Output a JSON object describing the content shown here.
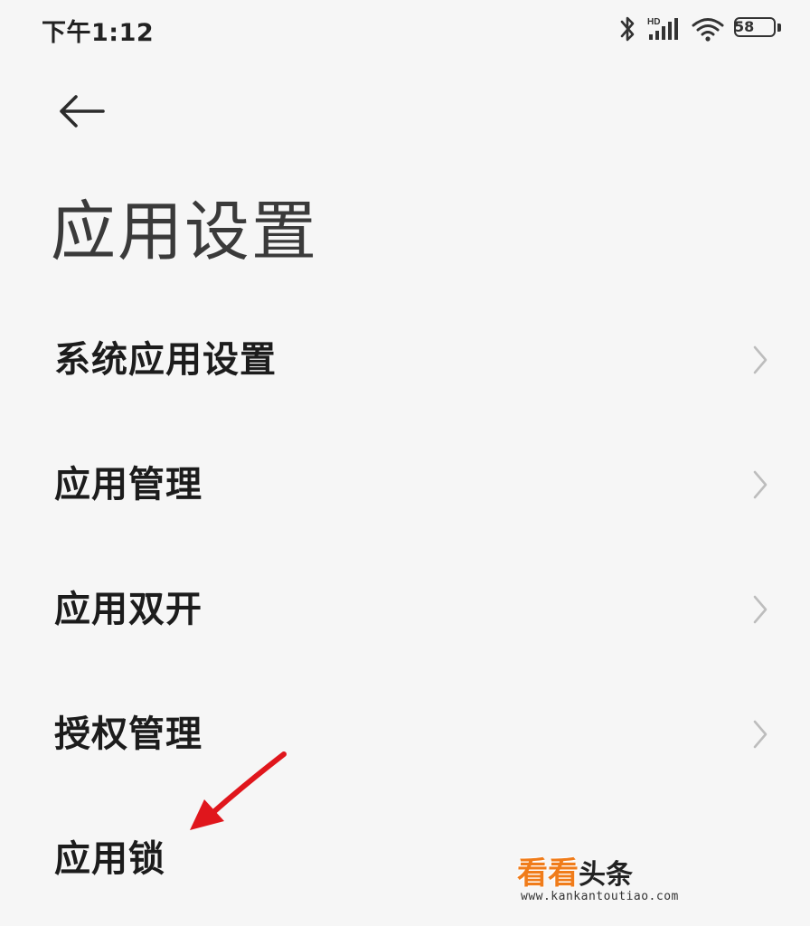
{
  "status_bar": {
    "time": "下午1:12",
    "battery_level": "58",
    "icons": [
      "bluetooth-icon",
      "hd-signal-icon",
      "wifi-icon",
      "battery-icon"
    ]
  },
  "header": {
    "back_icon": "arrow-left-icon",
    "title": "应用设置"
  },
  "menu": {
    "items": [
      {
        "label": "系统应用设置",
        "has_chevron": true
      },
      {
        "label": "应用管理",
        "has_chevron": true
      },
      {
        "label": "应用双开",
        "has_chevron": true
      },
      {
        "label": "授权管理",
        "has_chevron": true
      },
      {
        "label": "应用锁",
        "has_chevron": false
      }
    ]
  },
  "annotation": {
    "arrow_color": "#e0161c"
  },
  "watermark": {
    "brand": "看看",
    "suffix": "头条",
    "url": "www.kankantoutiao.com",
    "brand_color": "#f07c1a"
  }
}
